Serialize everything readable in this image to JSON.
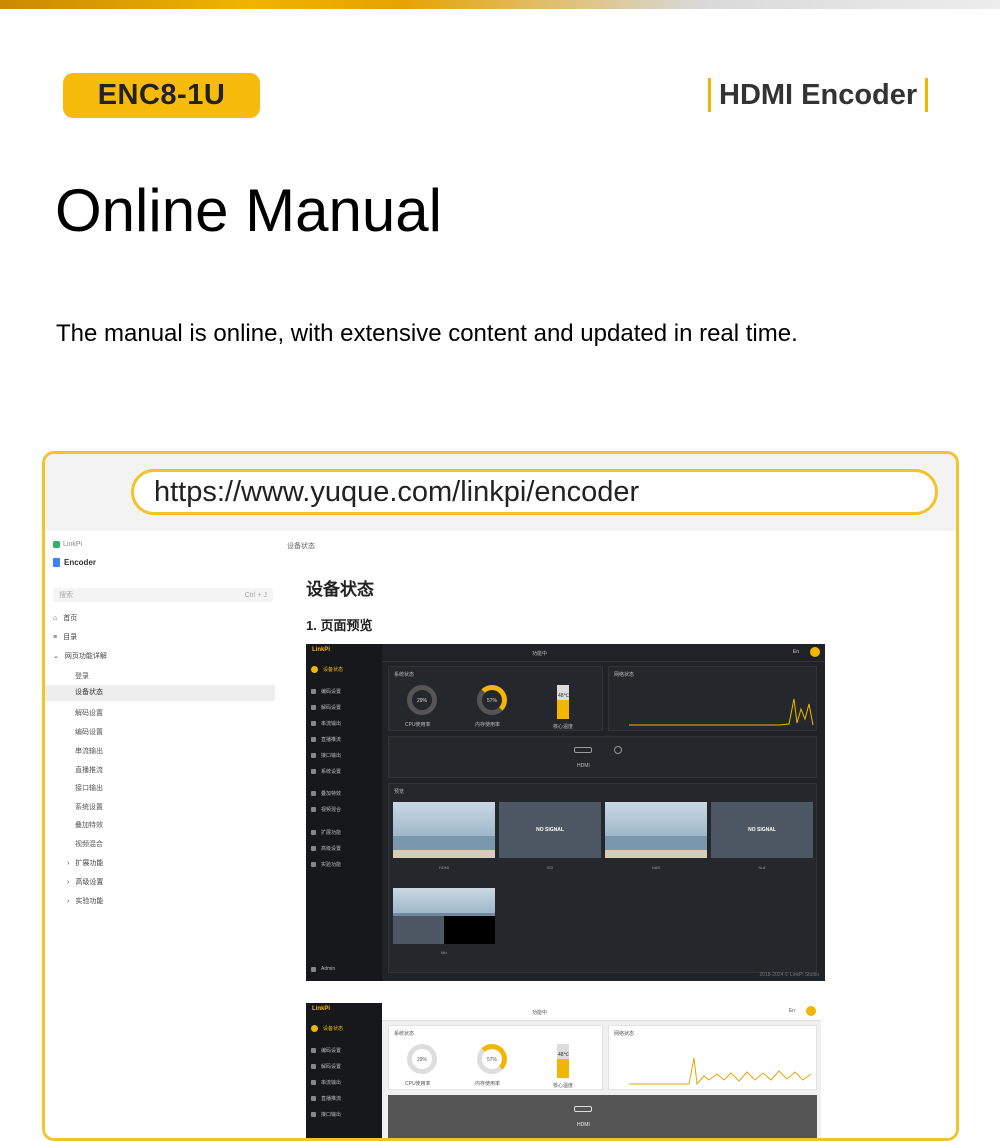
{
  "header": {
    "model": "ENC8-1U",
    "product_type": "HDMI Encoder"
  },
  "page_title": "Online Manual",
  "subtitle": "The manual is online, with extensive content and updated in real time.",
  "url": "https://www.yuque.com/linkpi/encoder",
  "docs": {
    "breadcrumb": "LinkPi",
    "book_title": "Encoder",
    "search_placeholder": "搜索",
    "search_shortcut": "Ctrl + J",
    "nav": {
      "home": "首页",
      "toc": "目录",
      "section": "网页功能详解"
    },
    "sub_items": [
      "登录",
      "设备状态",
      "解码设置",
      "编码设置",
      "串流输出",
      "直播推流",
      "接口输出",
      "系统设置",
      "叠加特效",
      "视频混合"
    ],
    "collapsed_items": [
      "扩展功能",
      "高级设置",
      "实验功能"
    ],
    "active_item": "设备状态",
    "content_breadcrumb": "设备状态",
    "heading": "设备状态",
    "subheading": "1. 页面预览"
  },
  "app_preview": {
    "logo": "LinkPi",
    "lang": "En",
    "search": "功能中",
    "nav_items": [
      "设备状态",
      "编码设置",
      "解码设置",
      "串流输出",
      "直播推流",
      "接口输出",
      "系统设置",
      "叠加特效",
      "视频混合",
      "扩展功能",
      "高级设置",
      "实验功能"
    ],
    "user": "Admin",
    "panel_device": "系统状态",
    "panel_network": "网络状态",
    "cpu_pct": "29%",
    "mem_pct": "57%",
    "temp_label": "48℃",
    "cpu_label": "CPU使用率",
    "mem_label": "内存使用率",
    "temp_caption": "核心温度",
    "hdmi_label": "HDMI",
    "preview_title": "预览",
    "no_signal": "NO SIGNAL",
    "captions": [
      "HDMI",
      "SDI",
      "NAS",
      "Null"
    ],
    "mix_caption": "Mix",
    "footer": "2018-2024 © LinkPi Studio"
  },
  "colors": {
    "accent": "#f2b600",
    "frame_border": "#f4c22a",
    "app_bg": "#1f2226"
  }
}
